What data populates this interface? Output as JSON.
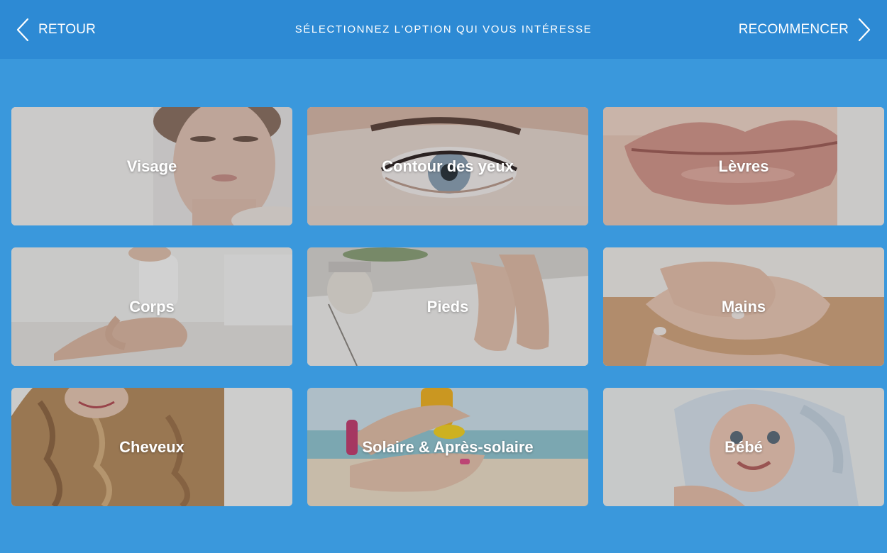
{
  "header": {
    "back_label": "RETOUR",
    "title": "SÉLECTIONNEZ L'OPTION QUI VOUS INTÉRESSE",
    "restart_label": "RECOMMENCER"
  },
  "colors": {
    "background": "#3a98dc",
    "header": "#2d8ad4",
    "text": "#ffffff"
  },
  "icons": {
    "back": "chevron-left-icon",
    "restart": "chevron-right-icon"
  },
  "categories": [
    {
      "label": "Visage"
    },
    {
      "label": "Contour des yeux"
    },
    {
      "label": "Lèvres"
    },
    {
      "label": "Corps"
    },
    {
      "label": "Pieds"
    },
    {
      "label": "Mains"
    },
    {
      "label": "Cheveux"
    },
    {
      "label": "Solaire & Après-solaire"
    },
    {
      "label": "Bébé"
    }
  ]
}
